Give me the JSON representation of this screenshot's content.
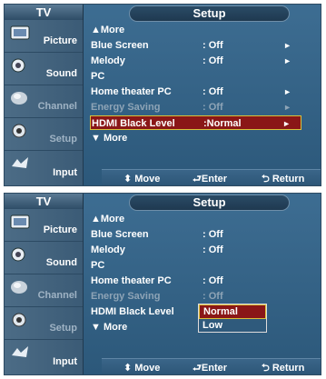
{
  "sidebar": {
    "title": "TV",
    "items": [
      {
        "label": "Picture",
        "icon": "picture-icon",
        "dim": false
      },
      {
        "label": "Sound",
        "icon": "sound-icon",
        "dim": false
      },
      {
        "label": "Channel",
        "icon": "channel-icon",
        "dim": true
      },
      {
        "label": "Setup",
        "icon": "setup-icon",
        "dim": true
      },
      {
        "label": "Input",
        "icon": "input-icon",
        "dim": false
      }
    ]
  },
  "panel1": {
    "header": "Setup",
    "rows": [
      {
        "name": "▲More",
        "value": "",
        "arrow": "",
        "state": "normal"
      },
      {
        "name": "Blue Screen",
        "value": ": Off",
        "arrow": "►",
        "state": "normal"
      },
      {
        "name": "Melody",
        "value": ": Off",
        "arrow": "►",
        "state": "normal"
      },
      {
        "name": "PC",
        "value": "",
        "arrow": "",
        "state": "normal"
      },
      {
        "name": "Home theater PC",
        "value": ": Off",
        "arrow": "►",
        "state": "normal"
      },
      {
        "name": "Energy Saving",
        "value": ": Off",
        "arrow": "►",
        "state": "dim"
      },
      {
        "name": "HDMI Black Level",
        "value": ":Normal",
        "arrow": "►",
        "state": "selected"
      },
      {
        "name": "▼ More",
        "value": "",
        "arrow": "",
        "state": "normal"
      }
    ],
    "footer": {
      "move": "⬍ Move",
      "enter": "⮐Enter",
      "return": "⮌ Return"
    }
  },
  "panel2": {
    "header": "Setup",
    "rows": [
      {
        "name": "▲More",
        "value": "",
        "state": "normal"
      },
      {
        "name": "Blue Screen",
        "value": ": Off",
        "state": "normal"
      },
      {
        "name": "Melody",
        "value": ": Off",
        "state": "normal"
      },
      {
        "name": "PC",
        "value": "",
        "state": "normal"
      },
      {
        "name": "Home theater PC",
        "value": ": Off",
        "state": "normal"
      },
      {
        "name": "Energy Saving",
        "value": ": Off",
        "state": "dim"
      },
      {
        "name": "HDMI Black Level",
        "value": ":",
        "state": "normal"
      },
      {
        "name": "▼ More",
        "value": "",
        "state": "normal"
      }
    ],
    "dropdown": {
      "options": [
        "Normal",
        "Low"
      ],
      "selected": "Normal"
    },
    "footer": {
      "move": "⬍ Move",
      "enter": "⮐Enter",
      "return": "⮌ Return"
    }
  },
  "colors": {
    "panel_bg": "#3d6d92",
    "sidebar_bg": "#4c6c86",
    "selection_bg": "#8a1717",
    "selection_border": "#d9c23a",
    "dim_text": "#8ea4b6"
  }
}
